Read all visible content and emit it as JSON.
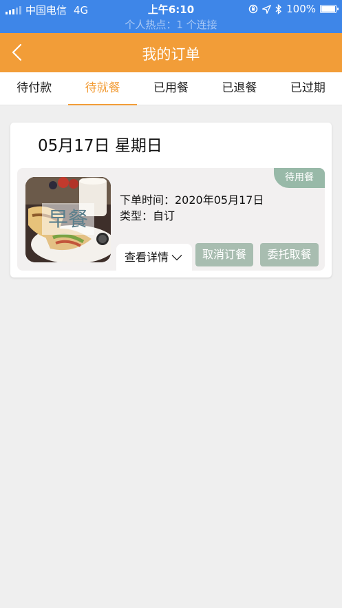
{
  "status_bar": {
    "carrier": "中国电信",
    "network": "4G",
    "time": "上午6:10",
    "battery": "100%",
    "hotspot": "个人热点：1 个连接"
  },
  "nav": {
    "title": "我的订单"
  },
  "tabs": [
    {
      "label": "待付款",
      "active": false
    },
    {
      "label": "待就餐",
      "active": true
    },
    {
      "label": "已用餐",
      "active": false
    },
    {
      "label": "已退餐",
      "active": false
    },
    {
      "label": "已过期",
      "active": false
    }
  ],
  "order_card": {
    "date": "05月17日 星期日",
    "status": "待用餐",
    "meal_label": "早餐",
    "order_time": "下单时间：2020年05月17日",
    "type": "类型：自订",
    "details_label": "查看详情",
    "cancel_label": "取消订餐",
    "delegate_label": "委托取餐"
  },
  "colors": {
    "status_bar_bg": "#3e86e8",
    "nav_bg": "#f29d38",
    "accent": "#f29d38",
    "action_button_bg": "#a8bdb0",
    "status_tag_bg": "#98b9a8"
  },
  "icons": [
    "signal-icon",
    "location-lock-icon",
    "location-arrow-icon",
    "bluetooth-icon",
    "battery-icon",
    "back-chevron-icon",
    "chevron-down-icon"
  ]
}
